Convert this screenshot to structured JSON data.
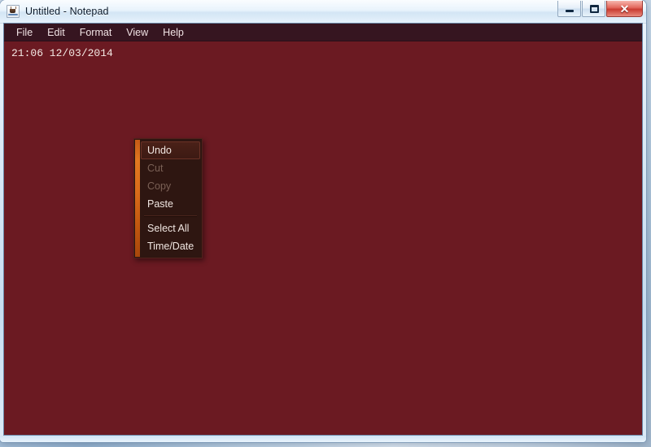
{
  "window": {
    "title": "Untitled - Notepad",
    "app_icon": "notepad-java-icon",
    "controls": {
      "minimize_label": "—",
      "maximize_label": "❐",
      "close_label": "✕",
      "minimize_name": "minimize",
      "maximize_name": "maximize",
      "close_name": "close"
    }
  },
  "menubar": {
    "items": [
      {
        "label": "File"
      },
      {
        "label": "Edit"
      },
      {
        "label": "Format"
      },
      {
        "label": "View"
      },
      {
        "label": "Help"
      }
    ]
  },
  "document": {
    "content": "21:06 12/03/2014",
    "placeholder": ""
  },
  "context_menu": {
    "items": [
      {
        "label": "Undo",
        "state": "highlighted"
      },
      {
        "label": "Cut",
        "state": "disabled"
      },
      {
        "label": "Copy",
        "state": "disabled"
      },
      {
        "label": "Paste",
        "state": "enabled"
      },
      {
        "label": "Select All",
        "state": "enabled"
      },
      {
        "label": "Time/Date",
        "state": "enabled"
      }
    ]
  },
  "colors": {
    "text_area_bg": "#6b1a22",
    "menu_bar_bg": "#361520",
    "context_menu_bg": "#2e1611",
    "accent_orange": "#d96c1a",
    "text_fg": "#f3e9e4",
    "disabled_fg": "#7a6055",
    "close_button": "#c93b31"
  }
}
